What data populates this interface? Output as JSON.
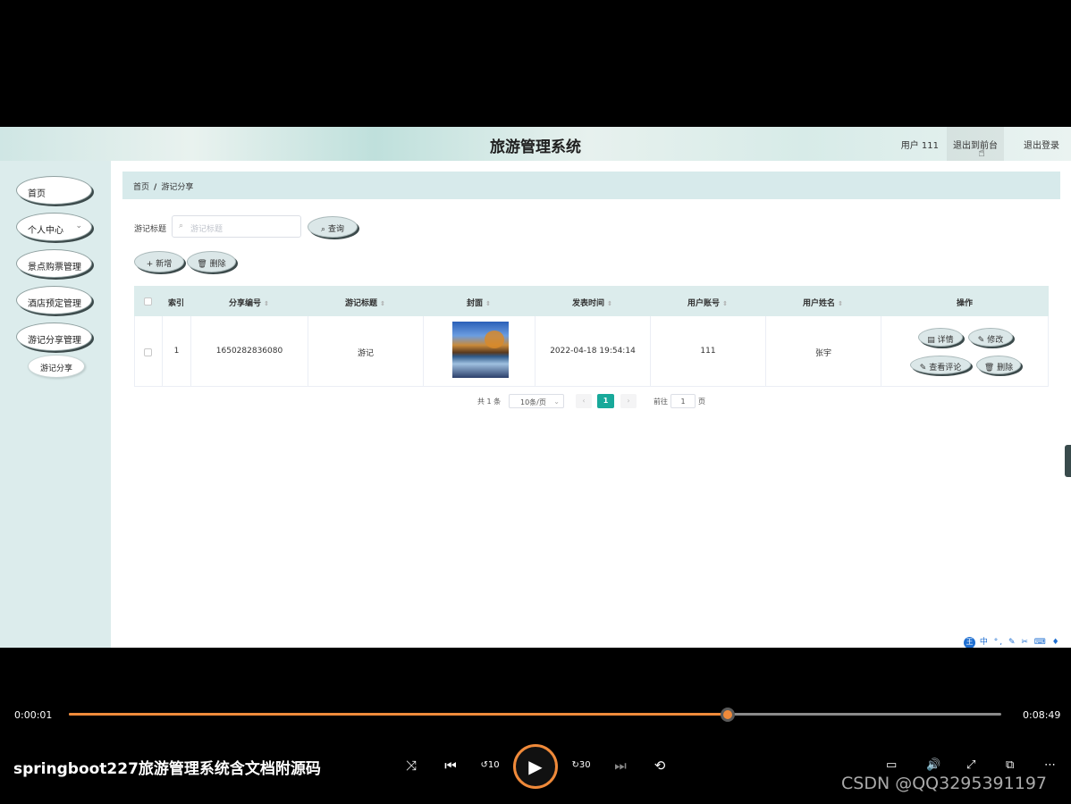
{
  "header": {
    "title": "旅游管理系统",
    "user": "用户 111",
    "to_front": "退出到前台",
    "logout": "退出登录"
  },
  "sidebar": {
    "items": [
      {
        "label": "首页"
      },
      {
        "label": "个人中心"
      },
      {
        "label": "景点购票管理"
      },
      {
        "label": "酒店预定管理"
      },
      {
        "label": "游记分享管理"
      }
    ],
    "sub_item": "游记分享"
  },
  "breadcrumb": {
    "home": "首页",
    "sep": "/",
    "current": "游记分享"
  },
  "search": {
    "label": "游记标题",
    "placeholder": "游记标题",
    "button": "查询"
  },
  "actions": {
    "add": "新增",
    "delete": "删除"
  },
  "table": {
    "headers": [
      "索引",
      "分享编号",
      "游记标题",
      "封面",
      "发表时间",
      "用户账号",
      "用户姓名",
      "操作"
    ],
    "rows": [
      {
        "index": "1",
        "share_no": "1650282836080",
        "title": "游记",
        "time": "2022-04-18 19:54:14",
        "account": "111",
        "name": "张宇"
      }
    ],
    "row_actions": {
      "detail": "详情",
      "edit": "修改",
      "comments": "查看评论",
      "delete": "删除"
    }
  },
  "pagination": {
    "total": "共 1 条",
    "page_size": "10条/页",
    "current": "1",
    "goto": "前往",
    "goto_value": "1",
    "page_unit": "页"
  },
  "ime": {
    "text": "中 °, ✎ ✂ ⌨ ♦ ⚙",
    "badge": "王"
  },
  "player": {
    "elapsed": "0:00:01",
    "duration": "0:08:49",
    "progress": 0.707,
    "title": "springboot227旅游管理系统含文档附源码",
    "rewind": "10",
    "forward": "30",
    "watermark": "CSDN @QQ3295391197"
  },
  "colors": {
    "accent": "#18a99a",
    "progress": "#f08a3a",
    "sidebar": "#dcecec"
  }
}
